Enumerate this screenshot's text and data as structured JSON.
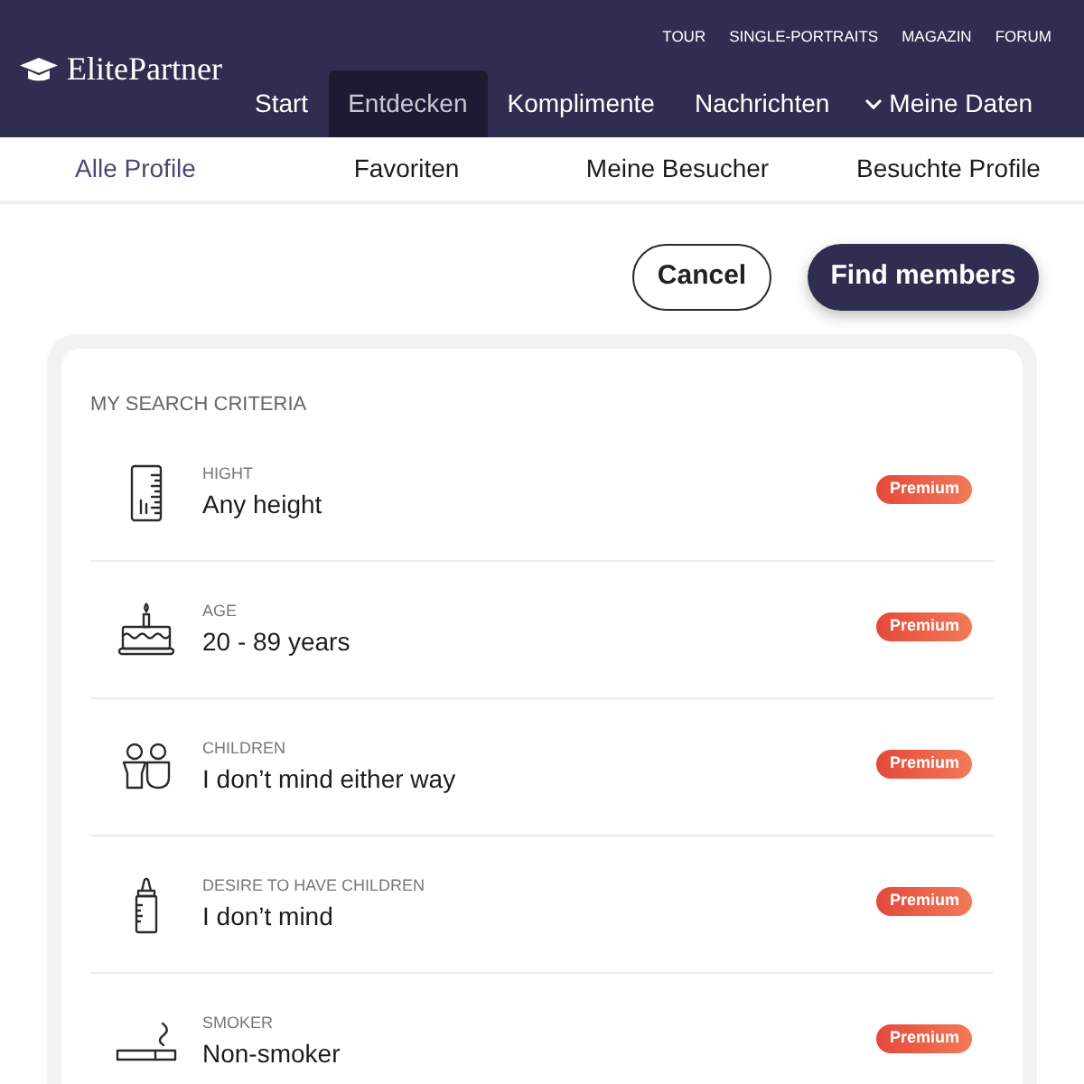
{
  "header": {
    "logo": "ElitePartner",
    "top_links": [
      "TOUR",
      "SINGLE-PORTRAITS",
      "MAGAZIN",
      "FORUM"
    ],
    "nav": [
      {
        "label": "Start",
        "kind": "link",
        "selected": false
      },
      {
        "label": "Entdecken",
        "kind": "link",
        "selected": true
      },
      {
        "label": "Komplimente",
        "kind": "link",
        "selected": false
      },
      {
        "label": "Nachrichten",
        "kind": "link",
        "selected": false
      },
      {
        "label": "Meine Daten",
        "kind": "dropdown",
        "selected": false
      }
    ]
  },
  "subnav": [
    {
      "label": "Alle Profile",
      "selected": true
    },
    {
      "label": "Favoriten",
      "selected": false
    },
    {
      "label": "Meine Besucher",
      "selected": false
    },
    {
      "label": "Besuchte Profile",
      "selected": false
    }
  ],
  "actions": {
    "cancel": "Cancel",
    "submit": "Find members"
  },
  "criteria": {
    "title": "MY SEARCH CRITERIA",
    "items": [
      {
        "kind": "height",
        "label": "HIGHT",
        "value": "Any height",
        "badge": "Premium"
      },
      {
        "kind": "age",
        "label": "AGE",
        "value": "20 - 89 years",
        "badge": "Premium"
      },
      {
        "kind": "children",
        "label": "CHILDREN",
        "value": "I don’t mind either way",
        "badge": "Premium"
      },
      {
        "kind": "desire",
        "label": "DESIRE TO HAVE CHILDREN",
        "value": "I don’t mind",
        "badge": "Premium"
      },
      {
        "kind": "smoker",
        "label": "SMOKER",
        "value": "Non-smoker",
        "badge": "Premium"
      }
    ]
  }
}
